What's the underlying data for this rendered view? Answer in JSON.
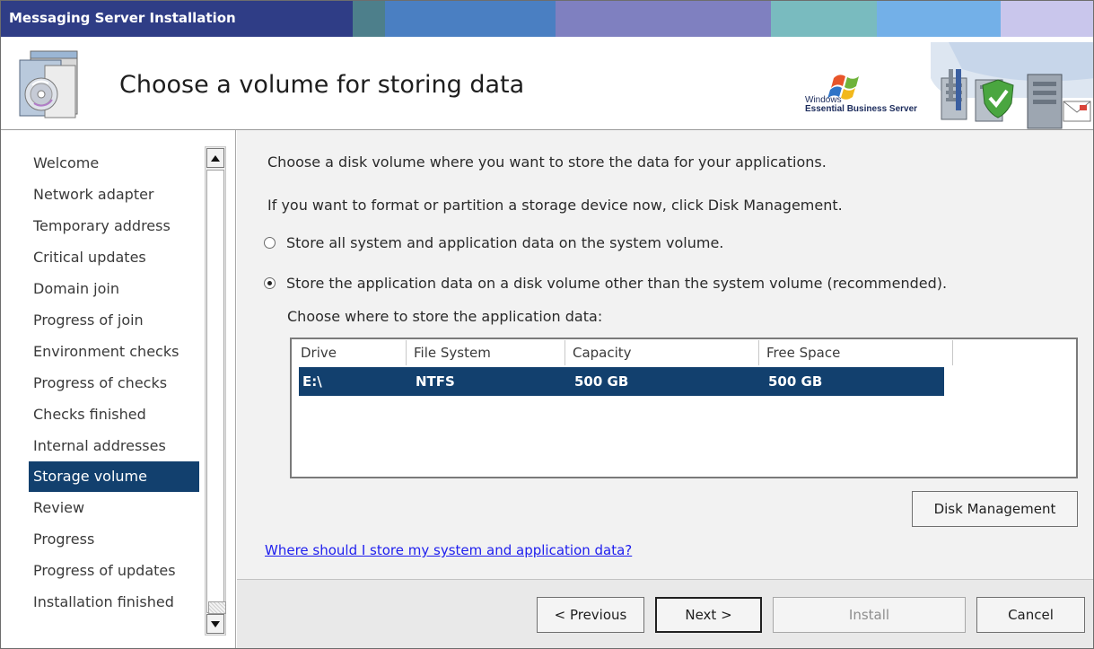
{
  "window": {
    "title": "Messaging Server Installation"
  },
  "header": {
    "page_title": "Choose a volume for storing data",
    "brand_line1": "Windows",
    "brand_line2": "Essential Business Server",
    "setup_icon": "install-disc-icon",
    "brand_icons": [
      "windows-flag-icon",
      "tools-server-icon",
      "shield-check-server-icon",
      "mail-server-icon"
    ]
  },
  "sidebar": {
    "items": [
      {
        "label": "Welcome",
        "active": false
      },
      {
        "label": "Network adapter",
        "active": false
      },
      {
        "label": "Temporary address",
        "active": false
      },
      {
        "label": "Critical updates",
        "active": false
      },
      {
        "label": "Domain join",
        "active": false
      },
      {
        "label": "Progress of join",
        "active": false
      },
      {
        "label": "Environment checks",
        "active": false
      },
      {
        "label": "Progress of checks",
        "active": false
      },
      {
        "label": "Checks finished",
        "active": false
      },
      {
        "label": "Internal addresses",
        "active": false
      },
      {
        "label": "Storage volume",
        "active": true
      },
      {
        "label": "Review",
        "active": false
      },
      {
        "label": "Progress",
        "active": false
      },
      {
        "label": "Progress of updates",
        "active": false
      },
      {
        "label": "Installation finished",
        "active": false
      }
    ]
  },
  "main": {
    "intro": "Choose a disk volume where you want to store the data for your applications.",
    "format_note": "If you want to format or partition a storage device now, click Disk Management.",
    "option_system": {
      "label": "Store all system and application data on the system volume.",
      "selected": false
    },
    "option_other": {
      "label": "Store the application data on a disk volume other than the system volume (recommended).",
      "selected": true
    },
    "choose_label": "Choose where to store the application data:",
    "table": {
      "columns": [
        "Drive",
        "File System",
        "Capacity",
        "Free Space"
      ],
      "rows": [
        {
          "drive": "E:\\",
          "file_system": "NTFS",
          "capacity": "500 GB",
          "free_space": "500 GB",
          "selected": true
        }
      ]
    },
    "disk_management_label": "Disk Management",
    "help_link": "Where should I store my system and application data?"
  },
  "footer": {
    "previous_label": "< Previous",
    "next_label": "Next >",
    "install_label": "Install",
    "cancel_label": "Cancel"
  },
  "colors": {
    "selection": "#12406e",
    "link": "#2020ee",
    "title_band": "#2f3d86"
  }
}
